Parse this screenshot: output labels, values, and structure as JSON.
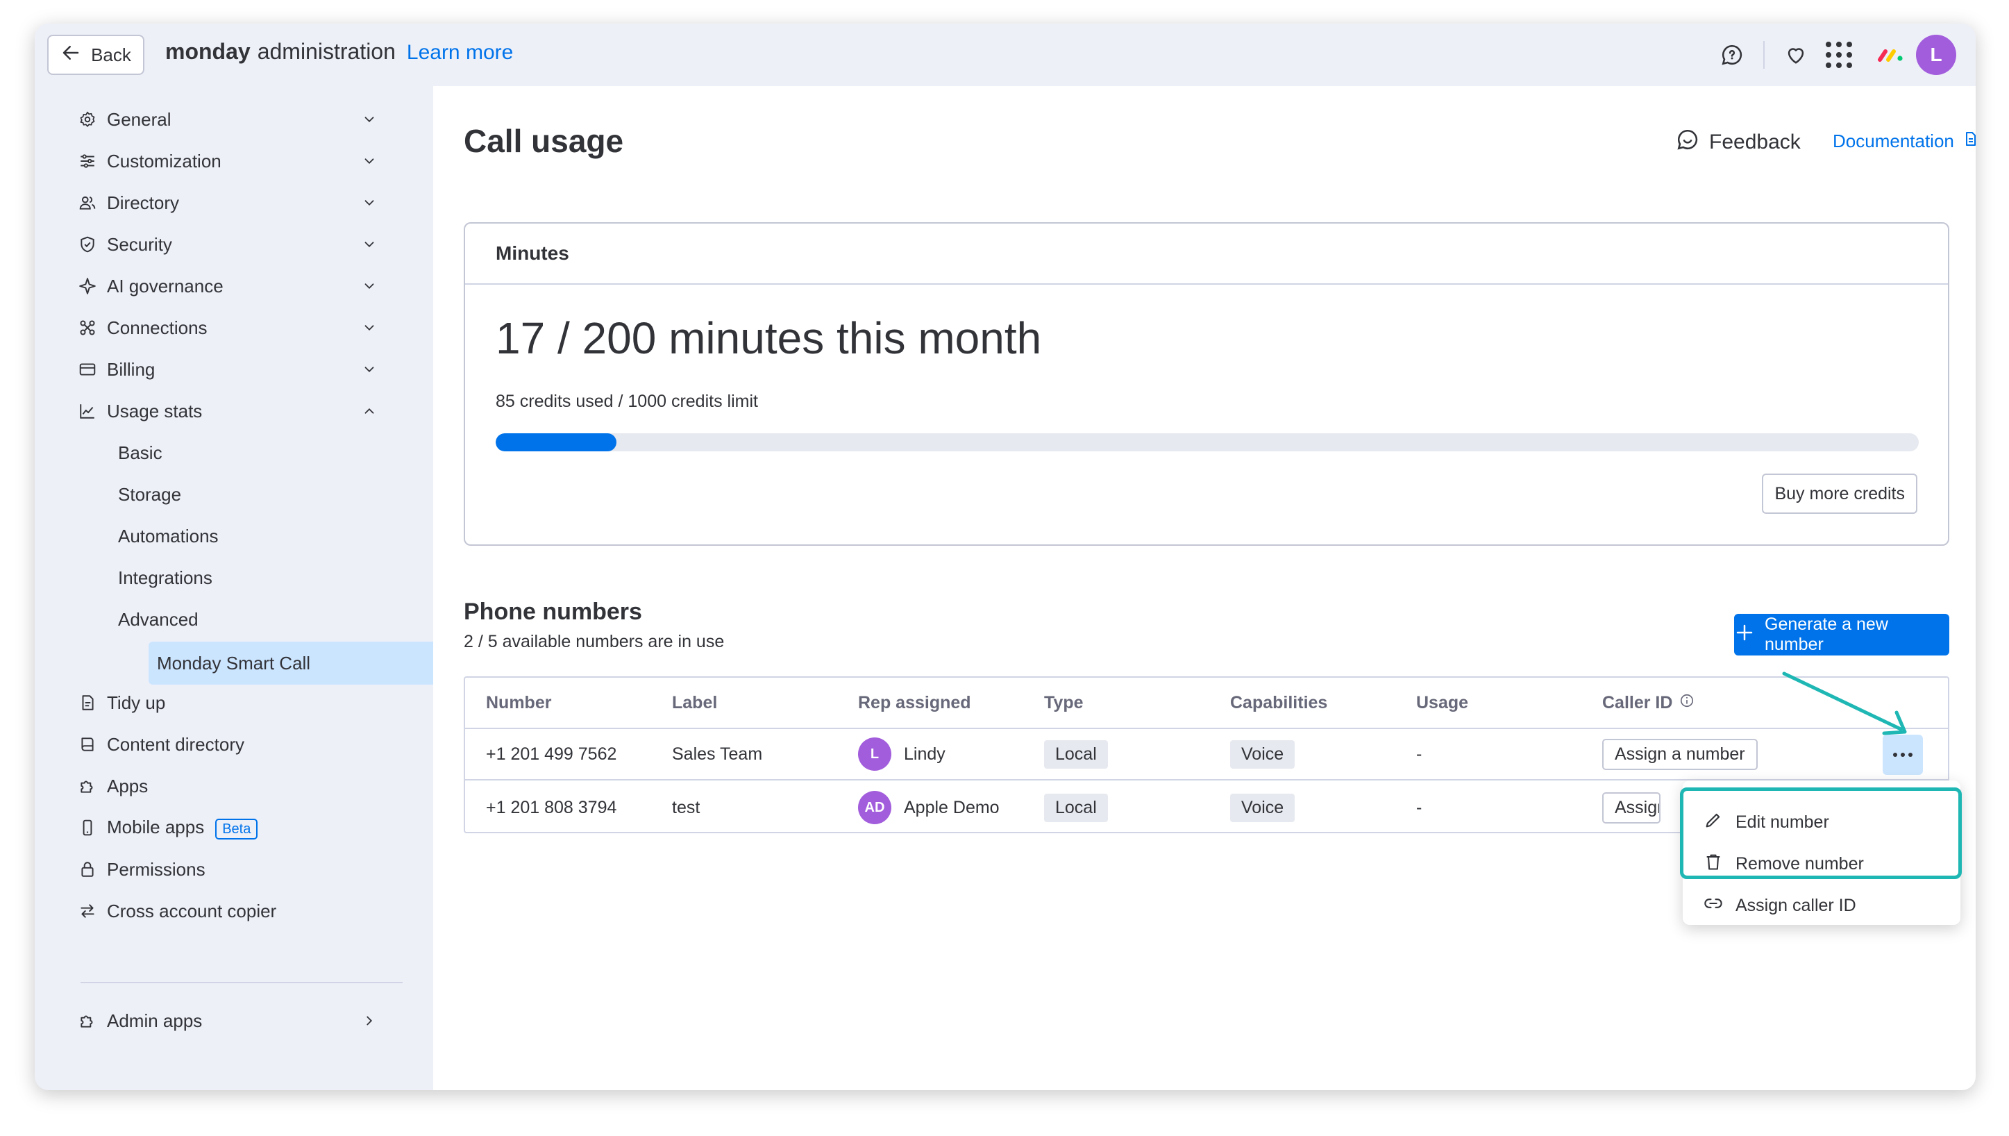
{
  "topbar": {
    "back_label": "Back",
    "brand_strong": "monday",
    "brand_rest": "administration",
    "learn_more": "Learn more",
    "avatar_initial": "L"
  },
  "sidebar": {
    "items": [
      {
        "label": "General",
        "icon": "gear-icon"
      },
      {
        "label": "Customization",
        "icon": "sliders-icon"
      },
      {
        "label": "Directory",
        "icon": "people-icon"
      },
      {
        "label": "Security",
        "icon": "shield-icon"
      },
      {
        "label": "AI governance",
        "icon": "sparkle-icon"
      },
      {
        "label": "Connections",
        "icon": "connections-icon"
      },
      {
        "label": "Billing",
        "icon": "credit-card-icon"
      },
      {
        "label": "Usage stats",
        "icon": "chart-icon"
      }
    ],
    "usage_sub": [
      "Basic",
      "Storage",
      "Automations",
      "Integrations",
      "Advanced",
      "Monday Smart Call"
    ],
    "lower_items": [
      {
        "label": "Tidy up",
        "icon": "broom-icon"
      },
      {
        "label": "Content directory",
        "icon": "book-icon"
      },
      {
        "label": "Apps",
        "icon": "puzzle-icon"
      },
      {
        "label": "Mobile apps",
        "icon": "mobile-icon"
      },
      {
        "label": "Permissions",
        "icon": "lock-icon"
      },
      {
        "label": "Cross account copier",
        "icon": "swap-icon"
      }
    ],
    "beta": "Beta",
    "admin_apps": "Admin apps"
  },
  "main": {
    "title": "Call usage",
    "feedback": "Feedback",
    "documentation": "Documentation",
    "minutes": {
      "header": "Minutes",
      "big": "17 / 200 minutes this month",
      "credits": "85 credits used / 1000 credits limit",
      "progress": 0.085,
      "buy": "Buy more credits"
    },
    "phone": {
      "title": "Phone numbers",
      "subtitle": "2 / 5 available numbers are in use",
      "generate": "Generate a new number",
      "columns": [
        "Number",
        "Label",
        "Rep assigned",
        "Type",
        "Capabilities",
        "Usage",
        "Caller ID"
      ],
      "rows": [
        {
          "number": "+1 201 499 7562",
          "label": "Sales Team",
          "initials": "L",
          "rep": "Lindy",
          "type": "Local",
          "cap": "Voice",
          "usage": "-",
          "caller": "Assign a number"
        },
        {
          "number": "+1 201 808 3794",
          "label": "test",
          "initials": "AD",
          "rep": "Apple Demo",
          "type": "Local",
          "cap": "Voice",
          "usage": "-",
          "caller": "Assign a number"
        }
      ]
    },
    "menu": [
      "Edit number",
      "Remove number",
      "Assign caller ID"
    ]
  },
  "colors": {
    "accent": "#0073ea",
    "highlight": "#1fb7b4",
    "active_bg": "#cce5ff",
    "avatar": "#a25ddc"
  }
}
